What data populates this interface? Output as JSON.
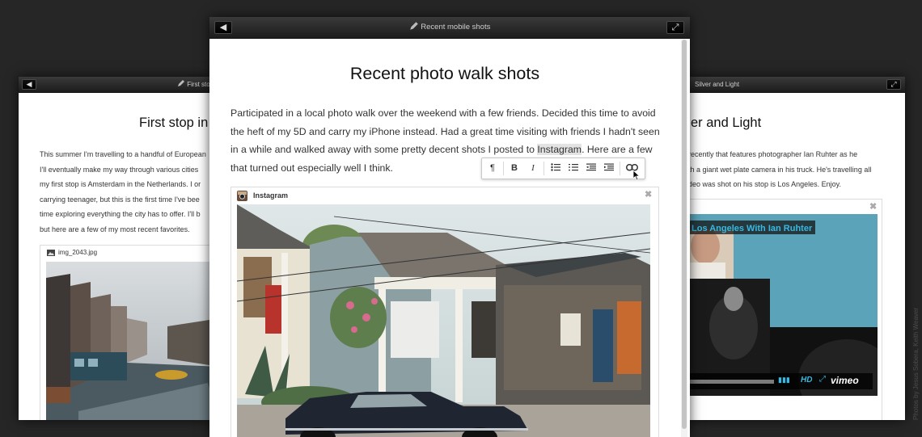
{
  "left_window": {
    "title": "First stop",
    "heading": "First stop in",
    "body_lines": [
      "This summer I'm travelling to a handful of European",
      "I'll eventually make my way through various cities",
      "my first stop is Amsterdam in the Netherlands. I or",
      "carrying teenager, but this is the first time I've bee",
      "time exploring everything the city has to offer. I'll b",
      "but here are a few of my most recent favorites."
    ],
    "attachment_name": "img_2043.jpg"
  },
  "right_window": {
    "title": "Silver and Light",
    "heading": "er and Light",
    "body_lines": [
      "recently that features photographer Ian Ruhter as he",
      "th a giant wet plate camera in his truck. He's travelling all",
      "deo was shot on his stop is Los Angeles. Enjoy."
    ],
    "video_title": "Los Angeles With Ian Ruhter",
    "video_hd": "HD",
    "video_brand": "vimeo"
  },
  "main_window": {
    "title": "Recent mobile shots",
    "heading": "Recent photo walk shots",
    "body_part1": "Participated in a local photo walk over the weekend with a few friends. Decided this time to avoid the heft of my 5D and carry my iPhone instead. Had a great time visiting with friends I hadn't seen in a while and walked away with some pretty decent shots I posted to ",
    "body_link": "Instagram",
    "body_part2": ". Here are a few that turned out especially well I think.",
    "embed_label": "Instagram"
  },
  "toolbar": {
    "paragraph": "¶",
    "bold": "B",
    "italic": "I"
  },
  "icons": {
    "back": "back-arrow-icon",
    "expand": "expand-icon",
    "pen": "pen-icon",
    "close": "close-icon"
  },
  "credit": "Photos by Jesus Sobera, Keith Weaver"
}
